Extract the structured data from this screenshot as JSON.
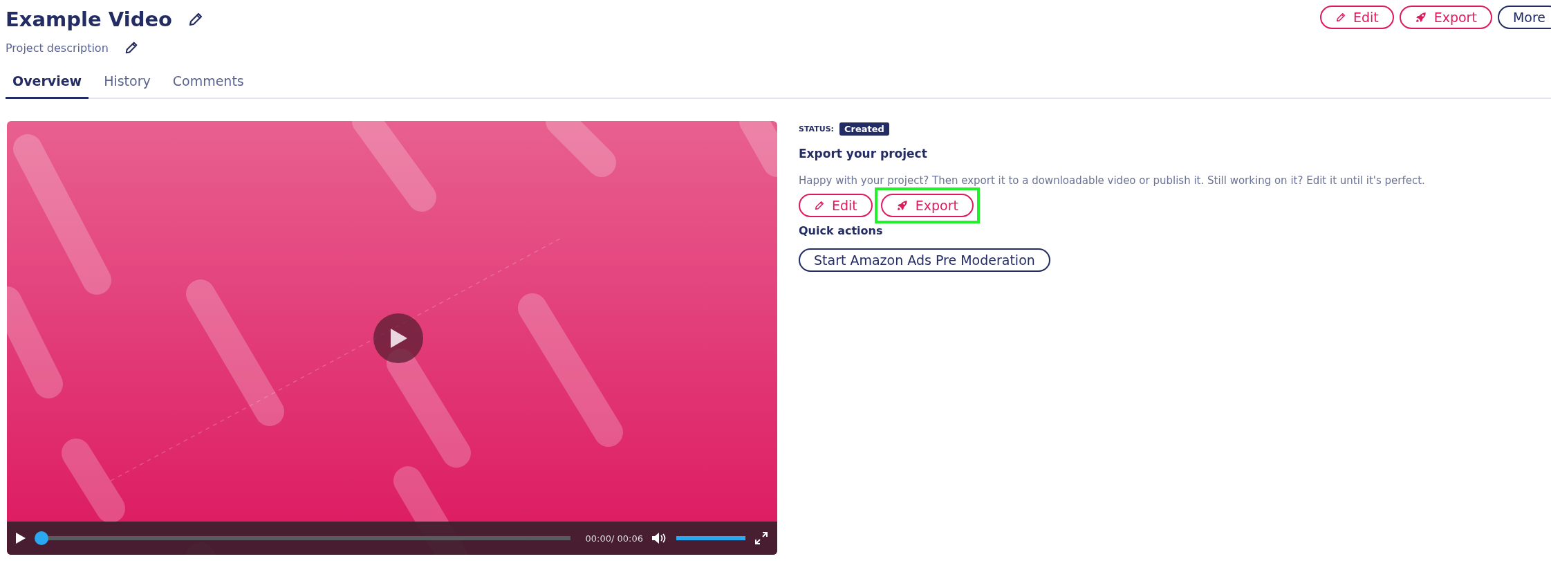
{
  "header": {
    "title": "Example Video",
    "description": "Project description"
  },
  "top_actions": [
    {
      "label": "Edit",
      "kind": "edit",
      "highlighted": false
    },
    {
      "label": "Export",
      "kind": "export",
      "highlighted": false
    },
    {
      "label": "More",
      "kind": "more",
      "highlighted": false
    }
  ],
  "tabs": [
    {
      "label": "Overview",
      "selected": true
    },
    {
      "label": "History",
      "selected": false
    },
    {
      "label": "Comments",
      "selected": false
    }
  ],
  "player": {
    "time": "00:00/ 00:06",
    "progress": {
      "level": 0
    },
    "volume": {
      "level": 1
    }
  },
  "panel": {
    "status_label": "STATUS:",
    "status": "Created",
    "heading": "Export your project",
    "text": "Happy with your project? Then export it to a downloadable video or publish it. Still working on it? Edit it until it's perfect.",
    "actions": [
      {
        "label": "Edit",
        "kind": "edit",
        "highlighted": false
      },
      {
        "label": "Export",
        "kind": "export",
        "highlighted": true
      }
    ],
    "quick_actions_heading": "Quick actions",
    "quick_actions": [
      {
        "label": "Start Amazon Ads Pre Moderation",
        "kind": "more",
        "highlighted": false
      }
    ]
  }
}
